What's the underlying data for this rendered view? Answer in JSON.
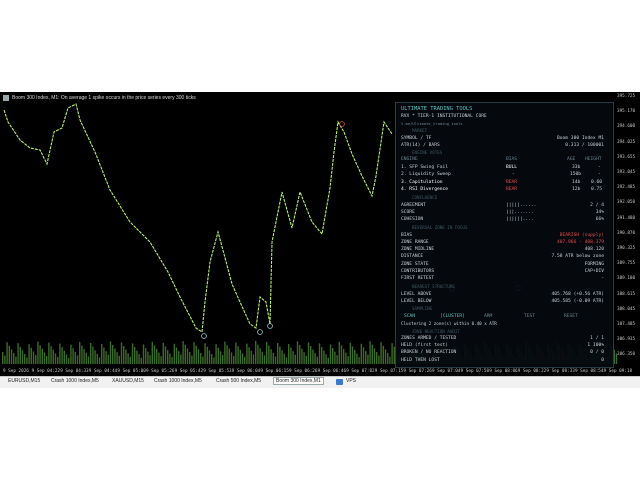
{
  "chart": {
    "title": "Boom 300 Index, M1: On average 1 spike occurs in the price series every 300 ticks",
    "y_ticks": [
      "395.725",
      "395.170",
      "394.600",
      "394.025",
      "393.655",
      "393.045",
      "392.485",
      "392.050",
      "391.480",
      "390.870",
      "390.325",
      "389.755",
      "389.180",
      "388.615",
      "388.045",
      "387.485",
      "386.935",
      "386.350"
    ],
    "x_ticks": [
      "9 Sep 2026",
      "9 Sep 04:22",
      "9 Sep 04:33",
      "9 Sep 04:44",
      "9 Sep 05:00",
      "9 Sep 05:26",
      "9 Sep 05:42",
      "9 Sep 05:53",
      "9 Sep 06:04",
      "9 Sep 06:15",
      "9 Sep 06:26",
      "9 Sep 06:46",
      "9 Sep 07:02",
      "9 Sep 07:15",
      "9 Sep 07:26",
      "9 Sep 07:04",
      "9 Sep 07:50",
      "9 Sep 08:06",
      "9 Sep 08:22",
      "9 Sep 08:33",
      "9 Sep 08:54",
      "9 Sep 09:18"
    ],
    "line_color": "#b8f06a",
    "volume_color": "#3b6b2a"
  },
  "tabs": {
    "items": [
      "EURUSD,M15",
      "Crash 1000 Index,M5",
      "XAUUSD,M15",
      "Crash 1000 Index,M5",
      "Crash 500 Index,M5",
      "Boom 300 Index,M1",
      "VPS"
    ],
    "active": "Boom 300 Index,M1"
  },
  "panel": {
    "title": "ULTIMATE TRADING TOOLS",
    "subtitle": "RVX * TIER-1 INSTITUTIONAL CORE",
    "handle": "t.me/Ultimate_trading_tools",
    "sections": {
      "market": "MARKET",
      "engine_votes": "ENGINE VOTES",
      "confluence": "CONFLUENCE",
      "reversal": "REVERSAL ZONE IN FOCUS",
      "nearest": "NEAREST STRUCTURE",
      "sampling": "SAMPLING",
      "zone_audit": "ZONE REACTION AUDIT"
    },
    "symbol_label": "SYMBOL / TF",
    "symbol_value": "Boom 300 Index  M1",
    "atr_label": "ATR(14) / BARS",
    "atr_value": "0.313  /  100001",
    "engine_head": {
      "engine": "ENGINE",
      "bias": "BIAS",
      "age": "AGE",
      "height": "HEIGHT"
    },
    "engines": [
      {
        "name": "1. SFP Swing Fail",
        "bias": "BULL",
        "age": "33b",
        "height": "-"
      },
      {
        "name": "2. Liquidity Sweep",
        "bias": "-",
        "age": "150b",
        "height": "-"
      },
      {
        "name": "3. Capitulation",
        "bias": "BEAR",
        "age": "14b",
        "height": "0.60"
      },
      {
        "name": "4. RSI Divergence",
        "bias": "BEAR",
        "age": "12b",
        "height": "0.75"
      }
    ],
    "agreement_label": "AGREEMENT",
    "agreement_bar": "|||||......",
    "agreement_value": "2 / 4",
    "score_label": "SCORE",
    "score_bar": "|||.......",
    "score_value": "34%",
    "cohesion_label": "COHESION",
    "cohesion_bar": "||||||....",
    "cohesion_value": "66%",
    "bias_label": "BIAS",
    "bias_value": "BEARISH  (supply)",
    "zone_range_label": "ZONE RANGE",
    "zone_range_value": "407.966 - 408.379",
    "zone_midline_label": "ZONE MIDLINE",
    "zone_midline_value": "408.120",
    "distance_label": "DISTANCE",
    "distance_value": "7.58 ATR below zone",
    "zone_state_label": "ZONE STATE",
    "zone_state_value": "FORMING",
    "contributors_label": "CONTRIBUTORS",
    "contributors_value": "CAP+DIV",
    "first_retest_label": "FIRST RETEST",
    "first_retest_value": "-",
    "level_above_label": "LEVEL ABOVE",
    "level_above_value": "405.768  (+0.56 ATR)",
    "level_below_label": "LEVEL BELOW",
    "level_below_value": "405.585  (-0.09 ATR)",
    "sampling_tabs": [
      "SCAN",
      "[CLUSTER]",
      "ARM",
      "TEST",
      "RESET"
    ],
    "clustering_text": "Clustering 2 zone(s) within 0.40 x ATR",
    "zones_armed_label": "ZONES ARMED / TESTED",
    "zones_armed_value": "1 / 1",
    "held_label": "HELD (first test)",
    "held_value": "1   100%",
    "broken_label": "BROKEN / NO REACTION",
    "broken_value": "0 / 0",
    "held_lost_label": "HELD THEN LOST",
    "held_lost_value": "0"
  }
}
